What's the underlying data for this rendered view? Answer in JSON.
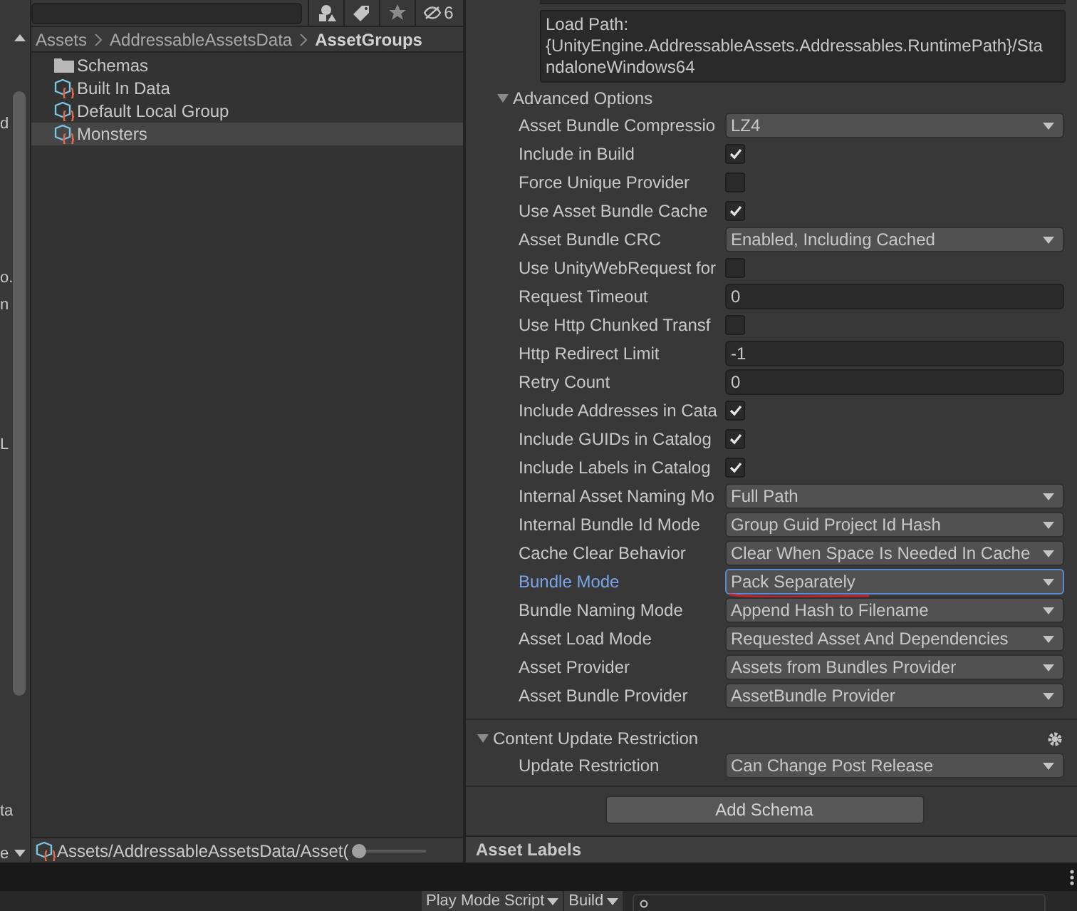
{
  "left_edge_fragments": [
    "d",
    "o.",
    "n",
    "L",
    "ta",
    "e"
  ],
  "toolbar": {
    "hidden_count": "6"
  },
  "project": {
    "breadcrumb": [
      {
        "label": "Assets",
        "current": false
      },
      {
        "label": "AddressableAssetsData",
        "current": false
      },
      {
        "label": "AssetGroups",
        "current": true
      }
    ],
    "items": [
      {
        "kind": "folder",
        "label": "Schemas",
        "selected": false
      },
      {
        "kind": "group",
        "label": "Built In Data",
        "selected": false
      },
      {
        "kind": "group",
        "label": "Default Local Group",
        "selected": false
      },
      {
        "kind": "group",
        "label": "Monsters",
        "selected": true
      }
    ],
    "path": "Assets/AddressableAssetsData/Asset(",
    "zoom_slider": {
      "level": 0
    }
  },
  "inspector": {
    "load_path": [
      "Load Path:",
      "{UnityEngine.AddressableAssets.Addressables.RuntimePath}/Sta",
      "ndaloneWindows64"
    ],
    "advanced": {
      "title": "Advanced Options",
      "expanded": true,
      "rows": [
        {
          "label": "Asset Bundle Compressio",
          "kind": "dropdown",
          "value": "LZ4",
          "highlighted": false
        },
        {
          "label": "Include in Build",
          "kind": "checkbox",
          "checked": true,
          "highlighted": false
        },
        {
          "label": "Force Unique Provider",
          "kind": "checkbox",
          "checked": false,
          "highlighted": false
        },
        {
          "label": "Use Asset Bundle Cache",
          "kind": "checkbox",
          "checked": true,
          "highlighted": false
        },
        {
          "label": "Asset Bundle CRC",
          "kind": "dropdown",
          "value": "Enabled, Including Cached",
          "highlighted": false
        },
        {
          "label": "Use UnityWebRequest for",
          "kind": "checkbox",
          "checked": false,
          "highlighted": false
        },
        {
          "label": "Request Timeout",
          "kind": "field",
          "value": "0",
          "highlighted": false
        },
        {
          "label": "Use Http Chunked Transf",
          "kind": "checkbox",
          "checked": false,
          "highlighted": false
        },
        {
          "label": "Http Redirect Limit",
          "kind": "field",
          "value": "-1",
          "highlighted": false
        },
        {
          "label": "Retry Count",
          "kind": "field",
          "value": "0",
          "highlighted": false
        },
        {
          "label": "Include Addresses in Cata",
          "kind": "checkbox",
          "checked": true,
          "highlighted": false
        },
        {
          "label": "Include GUIDs in Catalog",
          "kind": "checkbox",
          "checked": true,
          "highlighted": false
        },
        {
          "label": "Include Labels in Catalog",
          "kind": "checkbox",
          "checked": true,
          "highlighted": false
        },
        {
          "label": "Internal Asset Naming Mo",
          "kind": "dropdown",
          "value": "Full Path",
          "highlighted": false
        },
        {
          "label": "Internal Bundle Id Mode",
          "kind": "dropdown",
          "value": "Group Guid Project Id Hash",
          "highlighted": false
        },
        {
          "label": "Cache Clear Behavior",
          "kind": "dropdown",
          "value": "Clear When Space Is Needed In Cache",
          "highlighted": false
        },
        {
          "label": "Bundle Mode",
          "kind": "dropdown",
          "value": "Pack Separately",
          "highlighted": true
        },
        {
          "label": "Bundle Naming Mode",
          "kind": "dropdown",
          "value": "Append Hash to Filename",
          "highlighted": false
        },
        {
          "label": "Asset Load Mode",
          "kind": "dropdown",
          "value": "Requested Asset And Dependencies",
          "highlighted": false
        },
        {
          "label": "Asset Provider",
          "kind": "dropdown",
          "value": "Assets from Bundles Provider",
          "highlighted": false
        },
        {
          "label": "Asset Bundle Provider",
          "kind": "dropdown",
          "value": "AssetBundle Provider",
          "highlighted": false
        }
      ]
    },
    "content_update": {
      "title": "Content Update Restriction",
      "expanded": true,
      "rows": [
        {
          "label": "Update Restriction",
          "kind": "dropdown",
          "value": "Can Change Post Release",
          "highlighted": false
        }
      ]
    },
    "add_schema": "Add Schema",
    "labels_header": "Asset Labels"
  },
  "bottom_bar": {
    "buttons": [
      "Play Mode Script",
      "Build"
    ]
  }
}
